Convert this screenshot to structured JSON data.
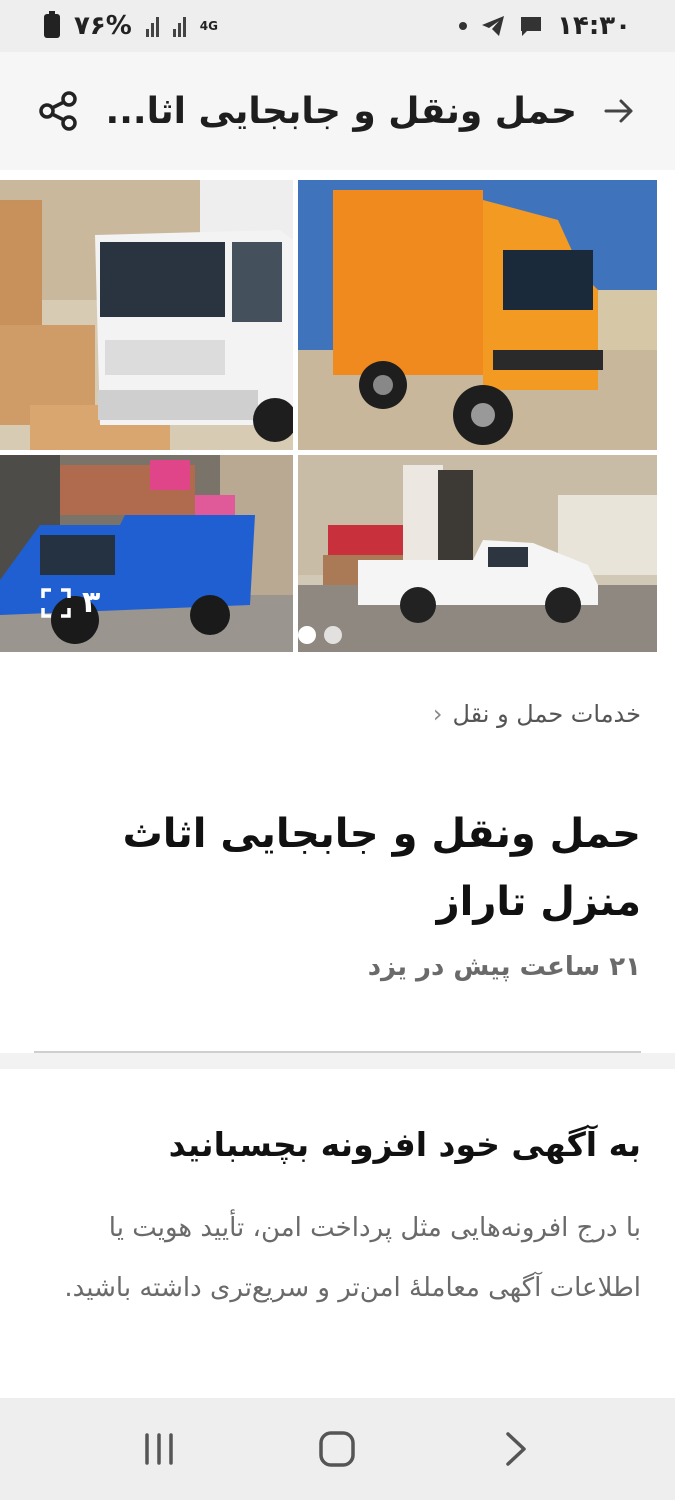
{
  "status_bar": {
    "battery": "۷۶%",
    "network": "4G",
    "time": "۱۴:۳۰"
  },
  "app_bar": {
    "title": "حمل ونقل و جابجایی اثا..."
  },
  "gallery": {
    "more_count": "۳",
    "images": [
      {
        "name": "orange-truck-photo",
        "color": "#f08a1e"
      },
      {
        "name": "white-isuzu-truck-photo",
        "color": "#f2f2f2"
      },
      {
        "name": "white-pickup-photo",
        "color": "#f5f5f5"
      },
      {
        "name": "blue-pickup-photo",
        "color": "#1f5fd1"
      }
    ]
  },
  "breadcrumb": {
    "label": "خدمات حمل و نقل"
  },
  "ad": {
    "title": "حمل ونقل و جابجایی اثاث منزل تاراز",
    "meta": "۲۱ ساعت پیش در یزد"
  },
  "promo": {
    "title": "به آگهی خود افزونه بچسبانید",
    "text": "با درج افرونه‌هایی مثل پرداخت امن، تأیید هویت یا اطلاعات آگهی معاملهٔ امن‌تر و سریع‌تری داشته باشید."
  },
  "colors": {
    "accent": "#1e1e1e",
    "muted": "#6a6a6a"
  }
}
